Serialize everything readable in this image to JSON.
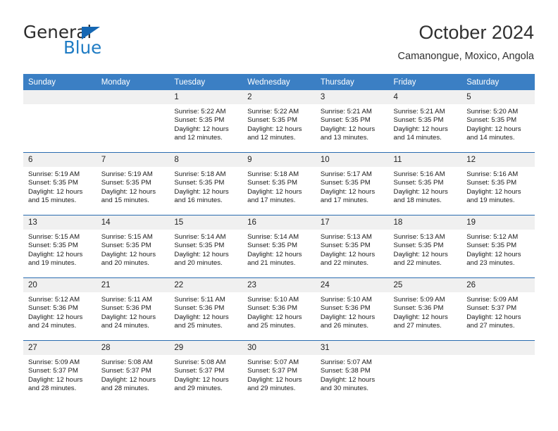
{
  "logo": {
    "word_top": "General",
    "word_bottom": "Blue",
    "triangle_color": "#1567b3",
    "blue_color": "#1f7cc4"
  },
  "header": {
    "title": "October 2024",
    "subtitle": "Camanongue, Moxico, Angola"
  },
  "theme": {
    "header_bg": "#3b7fc4",
    "row_divider": "#2a6cb0",
    "daynum_bg": "#f0f0f0"
  },
  "weekday_headers": [
    "Sunday",
    "Monday",
    "Tuesday",
    "Wednesday",
    "Thursday",
    "Friday",
    "Saturday"
  ],
  "weeks": [
    [
      {
        "day": "",
        "sunrise": "",
        "sunset": "",
        "daylight1": "",
        "daylight2": ""
      },
      {
        "day": "",
        "sunrise": "",
        "sunset": "",
        "daylight1": "",
        "daylight2": ""
      },
      {
        "day": "1",
        "sunrise": "Sunrise: 5:22 AM",
        "sunset": "Sunset: 5:35 PM",
        "daylight1": "Daylight: 12 hours",
        "daylight2": "and 12 minutes."
      },
      {
        "day": "2",
        "sunrise": "Sunrise: 5:22 AM",
        "sunset": "Sunset: 5:35 PM",
        "daylight1": "Daylight: 12 hours",
        "daylight2": "and 12 minutes."
      },
      {
        "day": "3",
        "sunrise": "Sunrise: 5:21 AM",
        "sunset": "Sunset: 5:35 PM",
        "daylight1": "Daylight: 12 hours",
        "daylight2": "and 13 minutes."
      },
      {
        "day": "4",
        "sunrise": "Sunrise: 5:21 AM",
        "sunset": "Sunset: 5:35 PM",
        "daylight1": "Daylight: 12 hours",
        "daylight2": "and 14 minutes."
      },
      {
        "day": "5",
        "sunrise": "Sunrise: 5:20 AM",
        "sunset": "Sunset: 5:35 PM",
        "daylight1": "Daylight: 12 hours",
        "daylight2": "and 14 minutes."
      }
    ],
    [
      {
        "day": "6",
        "sunrise": "Sunrise: 5:19 AM",
        "sunset": "Sunset: 5:35 PM",
        "daylight1": "Daylight: 12 hours",
        "daylight2": "and 15 minutes."
      },
      {
        "day": "7",
        "sunrise": "Sunrise: 5:19 AM",
        "sunset": "Sunset: 5:35 PM",
        "daylight1": "Daylight: 12 hours",
        "daylight2": "and 15 minutes."
      },
      {
        "day": "8",
        "sunrise": "Sunrise: 5:18 AM",
        "sunset": "Sunset: 5:35 PM",
        "daylight1": "Daylight: 12 hours",
        "daylight2": "and 16 minutes."
      },
      {
        "day": "9",
        "sunrise": "Sunrise: 5:18 AM",
        "sunset": "Sunset: 5:35 PM",
        "daylight1": "Daylight: 12 hours",
        "daylight2": "and 17 minutes."
      },
      {
        "day": "10",
        "sunrise": "Sunrise: 5:17 AM",
        "sunset": "Sunset: 5:35 PM",
        "daylight1": "Daylight: 12 hours",
        "daylight2": "and 17 minutes."
      },
      {
        "day": "11",
        "sunrise": "Sunrise: 5:16 AM",
        "sunset": "Sunset: 5:35 PM",
        "daylight1": "Daylight: 12 hours",
        "daylight2": "and 18 minutes."
      },
      {
        "day": "12",
        "sunrise": "Sunrise: 5:16 AM",
        "sunset": "Sunset: 5:35 PM",
        "daylight1": "Daylight: 12 hours",
        "daylight2": "and 19 minutes."
      }
    ],
    [
      {
        "day": "13",
        "sunrise": "Sunrise: 5:15 AM",
        "sunset": "Sunset: 5:35 PM",
        "daylight1": "Daylight: 12 hours",
        "daylight2": "and 19 minutes."
      },
      {
        "day": "14",
        "sunrise": "Sunrise: 5:15 AM",
        "sunset": "Sunset: 5:35 PM",
        "daylight1": "Daylight: 12 hours",
        "daylight2": "and 20 minutes."
      },
      {
        "day": "15",
        "sunrise": "Sunrise: 5:14 AM",
        "sunset": "Sunset: 5:35 PM",
        "daylight1": "Daylight: 12 hours",
        "daylight2": "and 20 minutes."
      },
      {
        "day": "16",
        "sunrise": "Sunrise: 5:14 AM",
        "sunset": "Sunset: 5:35 PM",
        "daylight1": "Daylight: 12 hours",
        "daylight2": "and 21 minutes."
      },
      {
        "day": "17",
        "sunrise": "Sunrise: 5:13 AM",
        "sunset": "Sunset: 5:35 PM",
        "daylight1": "Daylight: 12 hours",
        "daylight2": "and 22 minutes."
      },
      {
        "day": "18",
        "sunrise": "Sunrise: 5:13 AM",
        "sunset": "Sunset: 5:35 PM",
        "daylight1": "Daylight: 12 hours",
        "daylight2": "and 22 minutes."
      },
      {
        "day": "19",
        "sunrise": "Sunrise: 5:12 AM",
        "sunset": "Sunset: 5:35 PM",
        "daylight1": "Daylight: 12 hours",
        "daylight2": "and 23 minutes."
      }
    ],
    [
      {
        "day": "20",
        "sunrise": "Sunrise: 5:12 AM",
        "sunset": "Sunset: 5:36 PM",
        "daylight1": "Daylight: 12 hours",
        "daylight2": "and 24 minutes."
      },
      {
        "day": "21",
        "sunrise": "Sunrise: 5:11 AM",
        "sunset": "Sunset: 5:36 PM",
        "daylight1": "Daylight: 12 hours",
        "daylight2": "and 24 minutes."
      },
      {
        "day": "22",
        "sunrise": "Sunrise: 5:11 AM",
        "sunset": "Sunset: 5:36 PM",
        "daylight1": "Daylight: 12 hours",
        "daylight2": "and 25 minutes."
      },
      {
        "day": "23",
        "sunrise": "Sunrise: 5:10 AM",
        "sunset": "Sunset: 5:36 PM",
        "daylight1": "Daylight: 12 hours",
        "daylight2": "and 25 minutes."
      },
      {
        "day": "24",
        "sunrise": "Sunrise: 5:10 AM",
        "sunset": "Sunset: 5:36 PM",
        "daylight1": "Daylight: 12 hours",
        "daylight2": "and 26 minutes."
      },
      {
        "day": "25",
        "sunrise": "Sunrise: 5:09 AM",
        "sunset": "Sunset: 5:36 PM",
        "daylight1": "Daylight: 12 hours",
        "daylight2": "and 27 minutes."
      },
      {
        "day": "26",
        "sunrise": "Sunrise: 5:09 AM",
        "sunset": "Sunset: 5:37 PM",
        "daylight1": "Daylight: 12 hours",
        "daylight2": "and 27 minutes."
      }
    ],
    [
      {
        "day": "27",
        "sunrise": "Sunrise: 5:09 AM",
        "sunset": "Sunset: 5:37 PM",
        "daylight1": "Daylight: 12 hours",
        "daylight2": "and 28 minutes."
      },
      {
        "day": "28",
        "sunrise": "Sunrise: 5:08 AM",
        "sunset": "Sunset: 5:37 PM",
        "daylight1": "Daylight: 12 hours",
        "daylight2": "and 28 minutes."
      },
      {
        "day": "29",
        "sunrise": "Sunrise: 5:08 AM",
        "sunset": "Sunset: 5:37 PM",
        "daylight1": "Daylight: 12 hours",
        "daylight2": "and 29 minutes."
      },
      {
        "day": "30",
        "sunrise": "Sunrise: 5:07 AM",
        "sunset": "Sunset: 5:37 PM",
        "daylight1": "Daylight: 12 hours",
        "daylight2": "and 29 minutes."
      },
      {
        "day": "31",
        "sunrise": "Sunrise: 5:07 AM",
        "sunset": "Sunset: 5:38 PM",
        "daylight1": "Daylight: 12 hours",
        "daylight2": "and 30 minutes."
      },
      {
        "day": "",
        "sunrise": "",
        "sunset": "",
        "daylight1": "",
        "daylight2": ""
      },
      {
        "day": "",
        "sunrise": "",
        "sunset": "",
        "daylight1": "",
        "daylight2": ""
      }
    ]
  ]
}
